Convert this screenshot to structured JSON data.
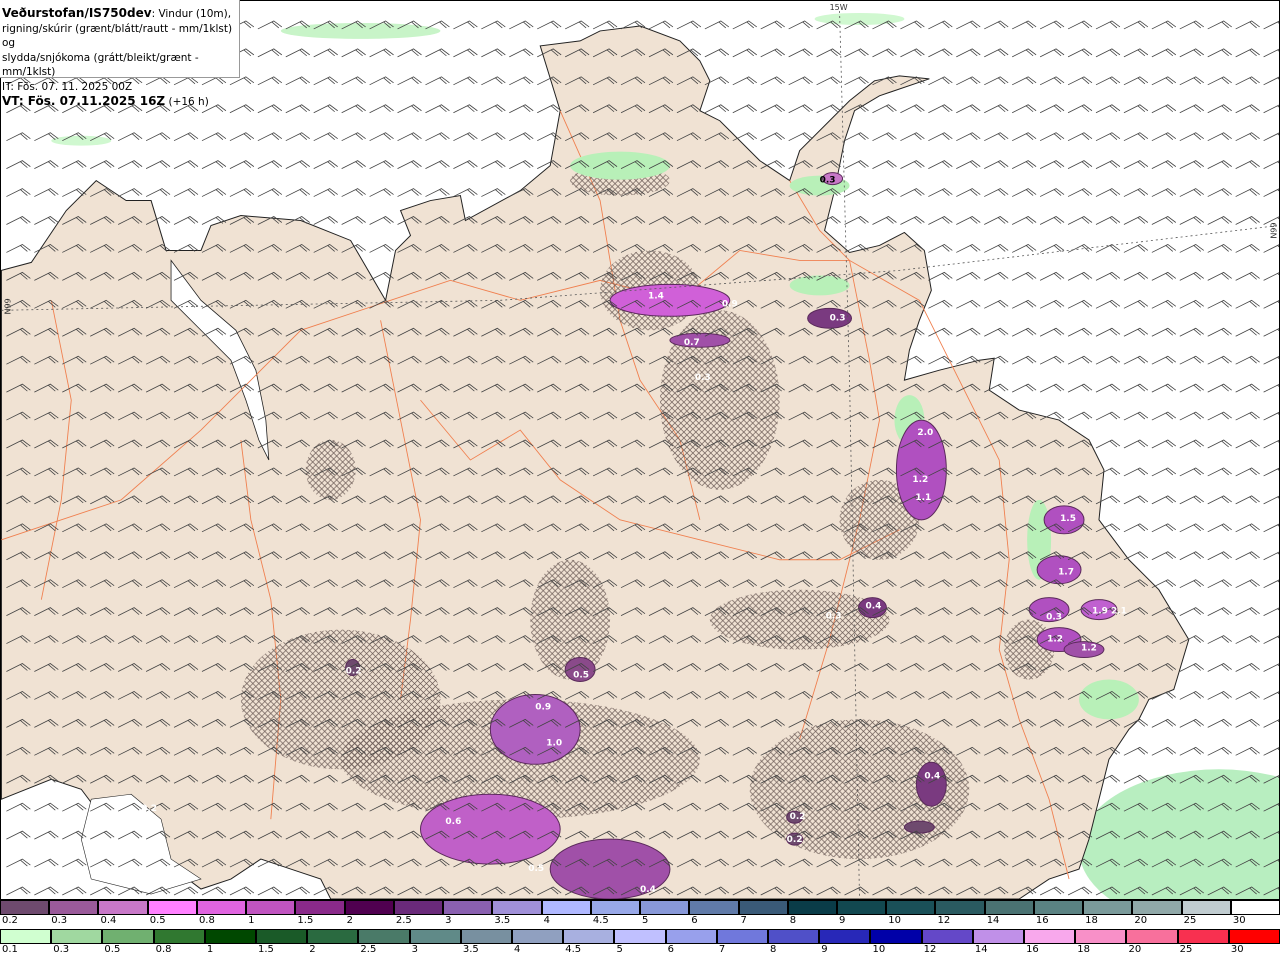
{
  "header": {
    "source": "Veðurstofan/IS750dev",
    "description_1": ": Vindur (10m),",
    "description_2": "rigning/skúrir (grænt/blátt/rautt - mm/1klst) og",
    "description_3": "slydda/snjókoma (grátt/bleikt/grænt - mm/1klst)",
    "initial_time": "IT: Fös. 07. 11. 2025 00Z",
    "valid_time": "VT: Fös. 07.11.2025 16Z",
    "lead_time": "(+16 h)"
  },
  "map": {
    "longitude_label": "15W",
    "latitude_label": "66N",
    "colors": {
      "sea": "#ffffff",
      "land": "#f0e2d3",
      "roads": "#f08050",
      "wind_barbs": "#444444"
    },
    "precip_labels": [
      "0.2",
      "1.4",
      "0.9",
      "0.7",
      "0.3",
      "0.3",
      "2.0",
      "1.2",
      "1.1",
      "1.5",
      "1.7",
      "1.9",
      "2.1",
      "1.2",
      "1.2",
      "0.3",
      "0.3",
      "0.4",
      "0.2",
      "0.5",
      "0.9",
      "1.0",
      "0.2",
      "0.6",
      "0.5",
      "0.4",
      "0.2",
      "0.4",
      "0.3"
    ]
  },
  "legend_snow": {
    "labels": [
      "0.2",
      "0.3",
      "0.4",
      "0.5",
      "0.8",
      "1",
      "1.5",
      "2",
      "2.5",
      "3",
      "3.5",
      "4",
      "4.5",
      "5",
      "6",
      "7",
      "8",
      "9",
      "10",
      "12",
      "14",
      "16",
      "18",
      "20",
      "25",
      "30"
    ],
    "colors": [
      "#6e4a6e",
      "#9a5a9a",
      "#c878c8",
      "#ff80ff",
      "#e064e0",
      "#c054c0",
      "#8a2a8a",
      "#500050",
      "#6a2a7a",
      "#8a60b0",
      "#a090d8",
      "#b0b8ff",
      "#98a8e8",
      "#8898d8",
      "#607aa8",
      "#3a5a78",
      "#0a3c48",
      "#124850",
      "#1a5058",
      "#2a5a60",
      "#4a7272",
      "#5a8282",
      "#7a9a9a",
      "#90a8a8",
      "#c0ccd0",
      "#ffffff"
    ]
  },
  "legend_rain": {
    "labels": [
      "0.1",
      "0.3",
      "0.5",
      "0.8",
      "1",
      "1.5",
      "2",
      "2.5",
      "3",
      "3.5",
      "4",
      "4.5",
      "5",
      "6",
      "7",
      "8",
      "9",
      "10",
      "12",
      "14",
      "16",
      "18",
      "20",
      "25",
      "30"
    ],
    "colors": [
      "#d0ffd0",
      "#a0d8a0",
      "#70b070",
      "#307830",
      "#004800",
      "#1a5a28",
      "#2a6a40",
      "#4a7a68",
      "#608a88",
      "#7890a0",
      "#90a0c0",
      "#a8b0e0",
      "#c0c0ff",
      "#98a0ec",
      "#7078dc",
      "#5050c8",
      "#2828b8",
      "#0000a8",
      "#6448c8",
      "#c090e8",
      "#f8a8ec",
      "#f890c8",
      "#f8709c",
      "#f83050",
      "#ff0000"
    ]
  }
}
